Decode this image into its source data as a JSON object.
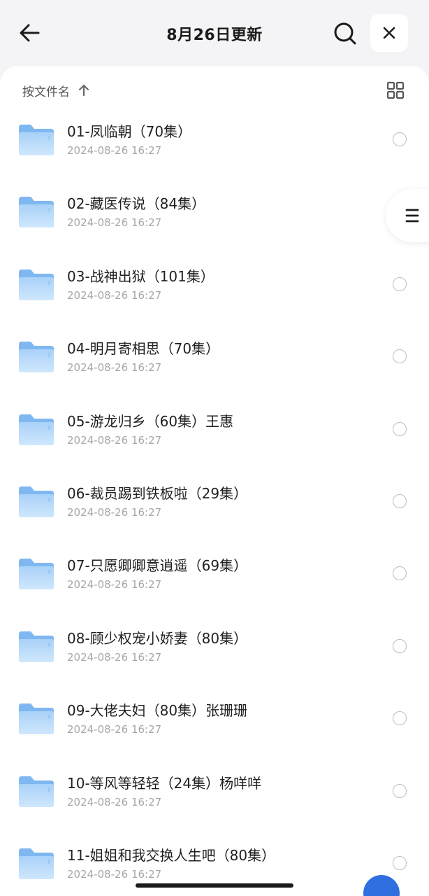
{
  "header": {
    "title": "8月26日更新"
  },
  "sort": {
    "label": "按文件名"
  },
  "colors": {
    "folder_light": "#b9dbfa",
    "folder_dark": "#7fb8f1",
    "fab": "#2f6fe0"
  },
  "icons": {
    "back": "arrow-left-icon",
    "search": "search-icon",
    "close": "close-icon",
    "sort": "arrow-up-icon",
    "grid": "grid-view-icon",
    "menu": "menu-icon",
    "folder": "folder-icon"
  },
  "items": [
    {
      "name": "01-凤临朝（70集）",
      "date": "2024-08-26 16:27"
    },
    {
      "name": "02-藏医传说（84集）",
      "date": "2024-08-26 16:27"
    },
    {
      "name": "03-战神出狱（101集）",
      "date": "2024-08-26 16:27"
    },
    {
      "name": "04-明月寄相思（70集）",
      "date": "2024-08-26 16:27"
    },
    {
      "name": "05-游龙归乡（60集）王惠",
      "date": "2024-08-26 16:27"
    },
    {
      "name": "06-裁员踢到铁板啦（29集）",
      "date": "2024-08-26 16:27"
    },
    {
      "name": "07-只愿卿卿意逍遥（69集）",
      "date": "2024-08-26 16:27"
    },
    {
      "name": "08-顾少权宠小娇妻（80集）",
      "date": "2024-08-26 16:27"
    },
    {
      "name": "09-大佬夫妇（80集）张珊珊",
      "date": "2024-08-26 16:27"
    },
    {
      "name": "10-等风等轻轻（24集）杨咩咩",
      "date": "2024-08-26 16:27"
    },
    {
      "name": "11-姐姐和我交换人生吧（80集）",
      "date": "2024-08-26 16:27"
    }
  ]
}
